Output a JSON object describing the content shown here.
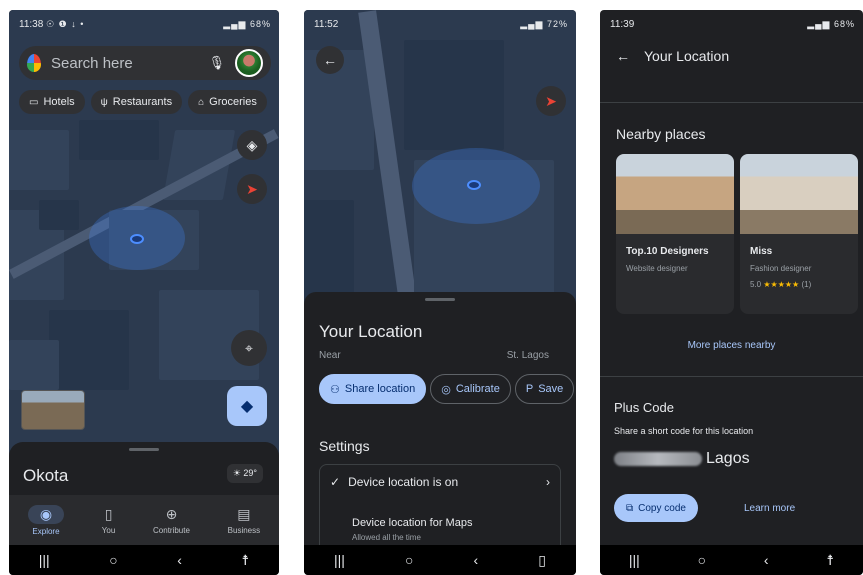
{
  "screen1": {
    "status": {
      "time": "11:38",
      "icons_left": "☉ ❶ ↓ •",
      "battery": "68%"
    },
    "search": {
      "placeholder": "Search here",
      "mic_icon": "mic-icon"
    },
    "chips": [
      {
        "icon": "▭",
        "label": "Hotels"
      },
      {
        "icon": "ψ",
        "label": "Restaurants"
      },
      {
        "icon": "⌂",
        "label": "Groceries"
      }
    ],
    "place_name": "Okota",
    "weather": "29°",
    "nav": [
      {
        "icon": "◉",
        "label": "Explore"
      },
      {
        "icon": "▯",
        "label": "You"
      },
      {
        "icon": "⊕",
        "label": "Contribute"
      },
      {
        "icon": "▤",
        "label": "Business"
      }
    ]
  },
  "screen2": {
    "status": {
      "time": "11:52",
      "battery": "72%"
    },
    "title": "Your Location",
    "near_label": "Near",
    "near_value": "St. Lagos",
    "buttons": [
      {
        "icon": "⚇",
        "label": "Share location"
      },
      {
        "icon": "◎",
        "label": "Calibrate"
      },
      {
        "icon": "P",
        "label": "Save"
      }
    ],
    "settings_heading": "Settings",
    "device_location": "Device location is on",
    "device_maps": "Device location for Maps",
    "device_maps_sub": "Allowed all the time"
  },
  "screen3": {
    "status": {
      "time": "11:39",
      "battery": "68%"
    },
    "title": "Your Location",
    "nearby_heading": "Nearby places",
    "places": [
      {
        "name": "Top.10 Designers",
        "type": "Website designer",
        "rating": "",
        "stars": "",
        "count": ""
      },
      {
        "name": "Miss",
        "type": "Fashion designer",
        "rating": "5.0",
        "stars": "★★★★★",
        "count": "(1)"
      }
    ],
    "more_link": "More places nearby",
    "plus_heading": "Plus Code",
    "plus_sub": "Share a short code for this location",
    "code_city": "Lagos",
    "copy_label": "Copy code",
    "learn_more": "Learn more"
  },
  "sysnav": {
    "recent": "|||",
    "home": "○",
    "back": "‹",
    "accessibility": "☨"
  },
  "colors": {
    "background": "#1f2023",
    "map": "#2c3a4f",
    "accent": "#a8c7fa",
    "location": "#4d8eff"
  }
}
